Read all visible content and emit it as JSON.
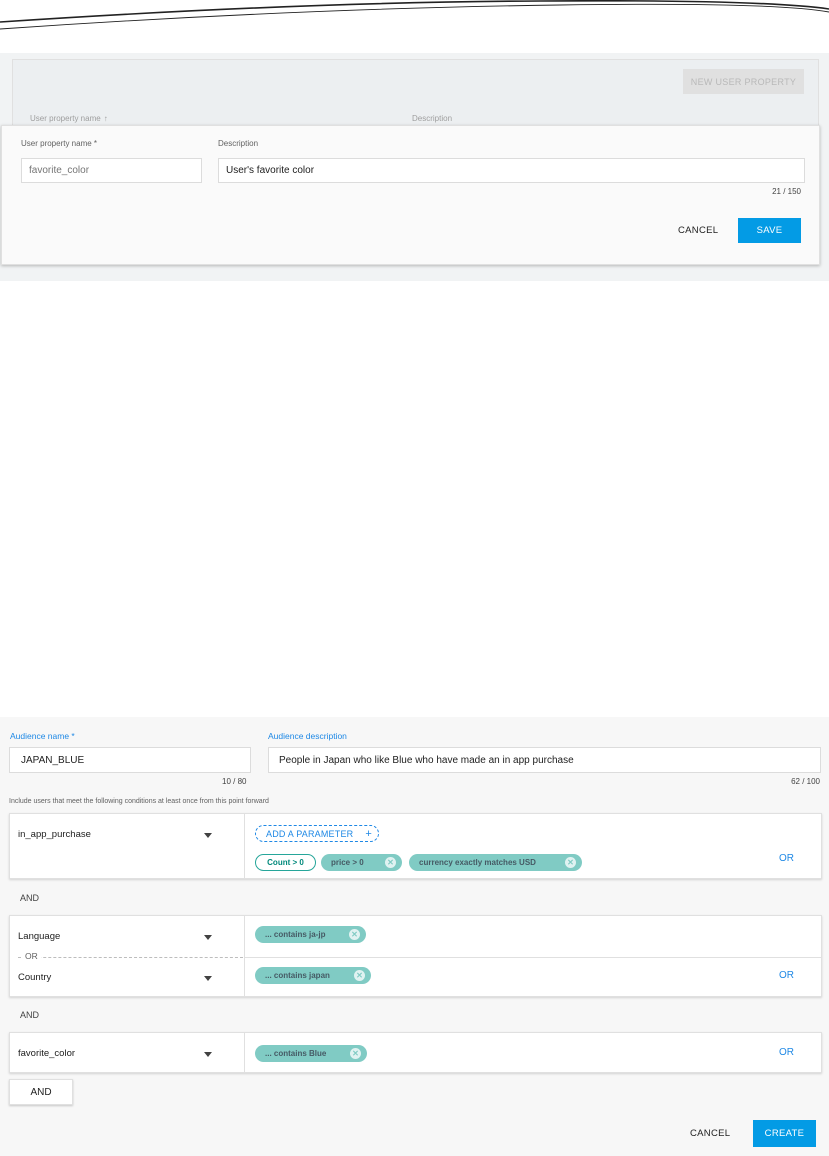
{
  "user_property": {
    "new_button_label": "NEW USER PROPERTY",
    "col_name_header": "User property name",
    "col_desc_header": "Description",
    "name_label": "User property name *",
    "name_placeholder": "favorite_color",
    "desc_label": "Description",
    "desc_value": "User's favorite color",
    "desc_counter": "21 / 150",
    "cancel_label": "CANCEL",
    "save_label": "SAVE"
  },
  "audience": {
    "name_label": "Audience name *",
    "name_value": "JAPAN_BLUE",
    "name_counter": "10 / 80",
    "desc_label": "Audience description",
    "desc_value": "People in Japan who like Blue who have made an in app purchase",
    "desc_counter": "62 / 100",
    "info": "Include users that meet the following conditions at least once from this point forward",
    "conditions": [
      {
        "event": "in_app_purchase",
        "add_param_label": "ADD A PARAMETER",
        "chips": [
          "Count > 0",
          "price > 0",
          "currency exactly matches USD"
        ],
        "or_label": "OR"
      },
      {
        "rows": [
          {
            "event": "Language",
            "chip": "... contains ja-jp"
          },
          {
            "event": "Country",
            "chip": "... contains japan"
          }
        ],
        "or_separator": "OR",
        "or_label": "OR"
      },
      {
        "event": "favorite_color",
        "chip": "... contains Blue",
        "or_label": "OR"
      }
    ],
    "and_label": "AND",
    "and_button_label": "AND",
    "cancel_label": "CANCEL",
    "create_label": "CREATE"
  },
  "colors": {
    "accent_blue": "#039be5",
    "chip_teal": "#80cbc4",
    "link_blue": "#1e88e5"
  },
  "icons": [
    "sort-arrow-up-icon",
    "dropdown-caret-icon",
    "chip-remove-icon",
    "plus-icon"
  ]
}
